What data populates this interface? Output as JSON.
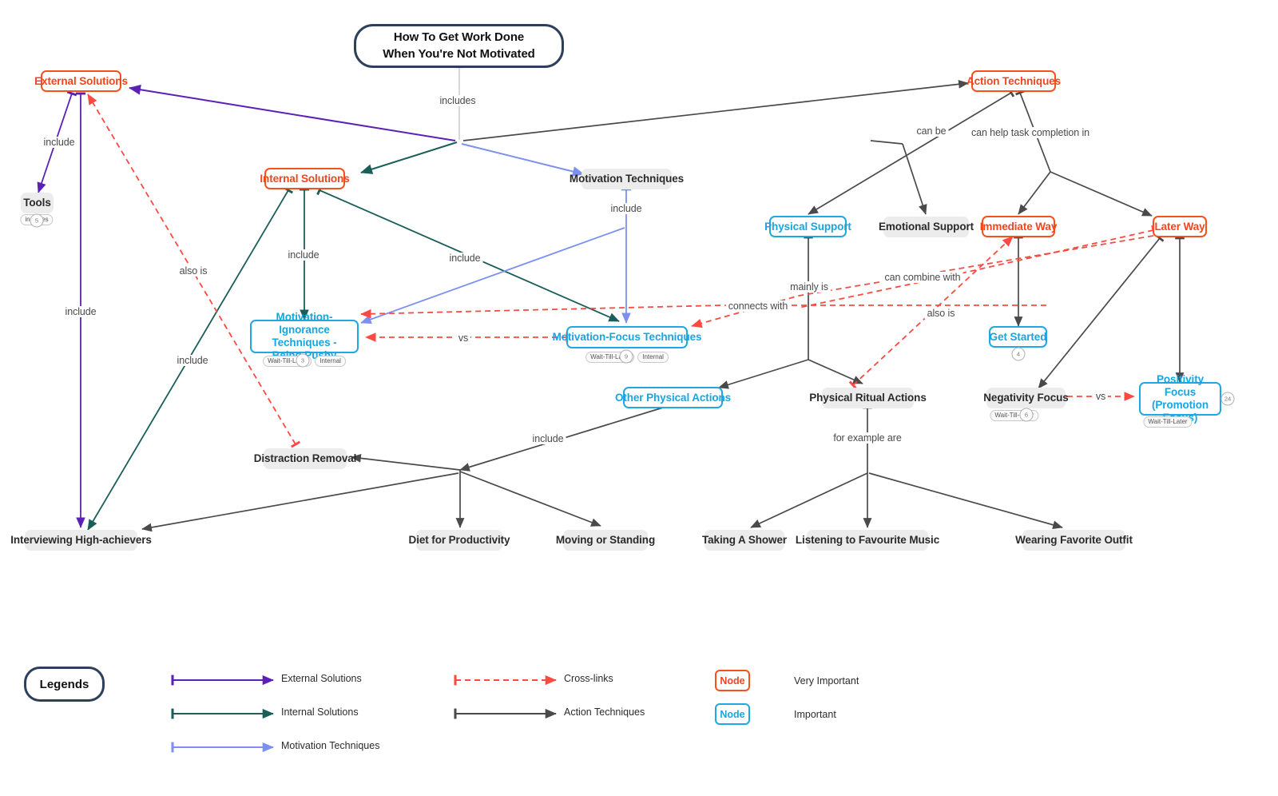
{
  "diagram": {
    "type": "concept-map",
    "root": {
      "label": "How To Get Work Done\nWhen You're Not Motivated"
    },
    "colors": {
      "external_solutions": "#5b21b6",
      "internal_solutions": "#1a5e5a",
      "motivation_techniques": "#7b90f0",
      "action_techniques": "#4a4a4a",
      "cross_links": "#fb4a42",
      "very_important_node": "#f4511e",
      "important_node": "#21a8e0",
      "plain_node": "#ececec",
      "root_border": "#2e3f5c"
    },
    "nodes": [
      {
        "id": "root",
        "label": "How To Get Work Done\nWhen You're Not Motivated",
        "kind": "root"
      },
      {
        "id": "external",
        "label": "External Solutions",
        "kind": "very-important"
      },
      {
        "id": "internal",
        "label": "Internal Solutions",
        "kind": "very-important"
      },
      {
        "id": "motivation",
        "label": "Motivation Techniques",
        "kind": "plain"
      },
      {
        "id": "action",
        "label": "Action Techniques",
        "kind": "very-important"
      },
      {
        "id": "tools",
        "label": "Tools",
        "kind": "plain",
        "tags": [
          "includes"
        ],
        "count": "5"
      },
      {
        "id": "interviewing",
        "label": "Interviewing High-achievers",
        "kind": "plain"
      },
      {
        "id": "ignorance",
        "label": "Motivation-Ignorance\nTechniques - Being Pushy",
        "kind": "important",
        "tags": [
          "Wait-Till-Later",
          "Internal"
        ],
        "count": "3"
      },
      {
        "id": "focus",
        "label": "Motivation-Focus Techniques",
        "kind": "important",
        "tags": [
          "Wait-Till-Later",
          "Internal"
        ],
        "count": "9"
      },
      {
        "id": "physical_support",
        "label": "Physical Support",
        "kind": "important"
      },
      {
        "id": "emotional_support",
        "label": "Emotional Support",
        "kind": "plain"
      },
      {
        "id": "immediate_way",
        "label": "Immediate Way",
        "kind": "very-important"
      },
      {
        "id": "later_way",
        "label": "Later Way",
        "kind": "very-important"
      },
      {
        "id": "get_started",
        "label": "Get Started",
        "kind": "important",
        "count": "4"
      },
      {
        "id": "negativity",
        "label": "Negativity Focus",
        "kind": "plain",
        "tags": [
          "Wait-Till-Later"
        ],
        "count": "6"
      },
      {
        "id": "positivity",
        "label": "Positivity Focus\n(Promotion Focus)",
        "kind": "important",
        "tags": [
          "Wait-Till-Later"
        ],
        "count": "24"
      },
      {
        "id": "other_physical",
        "label": "Other Physical Actions",
        "kind": "important"
      },
      {
        "id": "ritual",
        "label": "Physical Ritual Actions",
        "kind": "plain"
      },
      {
        "id": "distraction",
        "label": "Distraction Removal",
        "kind": "plain"
      },
      {
        "id": "diet",
        "label": "Diet for Productivity",
        "kind": "plain"
      },
      {
        "id": "moving",
        "label": "Moving or Standing",
        "kind": "plain"
      },
      {
        "id": "shower",
        "label": "Taking A Shower",
        "kind": "plain"
      },
      {
        "id": "music",
        "label": "Listening to Favourite Music",
        "kind": "plain"
      },
      {
        "id": "outfit",
        "label": "Wearing Favorite Outfit",
        "kind": "plain"
      }
    ],
    "edge_labels": {
      "includes_root": "includes",
      "include_tools": "include",
      "include_interviewing": "include",
      "include_ignorance": "include",
      "include_focus_internal": "include",
      "include_focus_motivation": "include",
      "include_interviewing_internal": "include",
      "also_is_external": "also is",
      "can_be": "can be",
      "can_help": "can help task completion in",
      "mainly_is": "mainly is",
      "connects_with": "connects with",
      "can_combine_with": "can combine with",
      "also_is_immediate": "also is",
      "vs_techniques": "vs",
      "vs_focus": "vs",
      "include_other_physical": "include",
      "for_example_are": "for example are"
    }
  },
  "legends": {
    "title": "Legends",
    "line_items": [
      {
        "label": "External Solutions",
        "color": "#5b21b6",
        "style": "solid"
      },
      {
        "label": "Internal Solutions",
        "color": "#1a5e5a",
        "style": "solid"
      },
      {
        "label": "Motivation Techniques",
        "color": "#7b90f0",
        "style": "solid"
      },
      {
        "label": "Cross-links",
        "color": "#fb4a42",
        "style": "dashed"
      },
      {
        "label": "Action Techniques",
        "color": "#4a4a4a",
        "style": "solid"
      }
    ],
    "node_items": [
      {
        "sample": "Node",
        "label": "Very Important",
        "color": "#f4511e"
      },
      {
        "sample": "Node",
        "label": "Important",
        "color": "#21a8e0"
      }
    ]
  }
}
